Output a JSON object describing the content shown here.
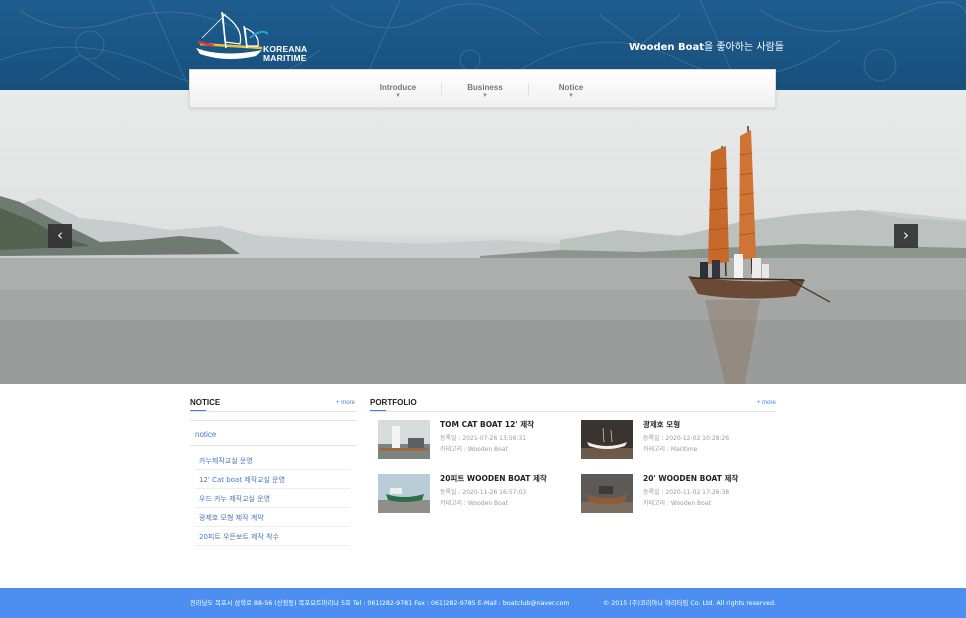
{
  "header": {
    "logo_line1": "KOREANA",
    "logo_line2": "MARITIME",
    "tagline_bold": "Wooden Boat",
    "tagline_rest": "을 좋아하는 사람들"
  },
  "nav": {
    "items": [
      {
        "label": "Introduce"
      },
      {
        "label": "Business"
      },
      {
        "label": "Notice"
      }
    ]
  },
  "hero": {
    "prev_icon": "chevron-left-icon",
    "next_icon": "chevron-right-icon",
    "prev_glyph": "‹",
    "next_glyph": "›"
  },
  "notice": {
    "title": "NOTICE",
    "more": "+ more",
    "category": "notice",
    "items": [
      "카누제작교실 운영",
      "12' Cat boat 제작교실 운영",
      "우드 카누 제작교실 운영",
      "광제호 모형 제작 계약",
      "20피트 우든보트 제작 착수"
    ]
  },
  "portfolio": {
    "title": "PORTFOLIO",
    "more": "+ more",
    "items": [
      {
        "title": "TOM CAT BOAT 12' 제작",
        "date": "등록일 : 2021-07-26 13:56:31",
        "category": "카테고리 : Wooden Boat"
      },
      {
        "title": "광제호 모형",
        "date": "등록일 : 2020-12-02 10:28:26",
        "category": "카테고리 : Maritime"
      },
      {
        "title": "20피트 WOODEN BOAT 제작",
        "date": "등록일 : 2020-11-26 16:57:03",
        "category": "카테고리 : Wooden Boat"
      },
      {
        "title": "20' WOODEN BOAT 제작",
        "date": "등록일 : 2020-11-02 17:26:38",
        "category": "카테고리 : Wooden Boat"
      }
    ]
  },
  "footer": {
    "address": "전라남도 목포시 삼학로 88-56 (산정동) 목포요트마리나 5호 Tel : 061)282-9781 Fax : 061)282-9785 E-Mail : boatclub@naver.com",
    "copyright": "© 2015 (주)코리아나 마리타임 Co. Ltd. All rights reserved."
  },
  "colors": {
    "header_blue": "#1e5d8e",
    "accent_blue": "#3f7fd8",
    "footer_blue": "#4d8ff0",
    "sail_orange": "#c8692c"
  }
}
